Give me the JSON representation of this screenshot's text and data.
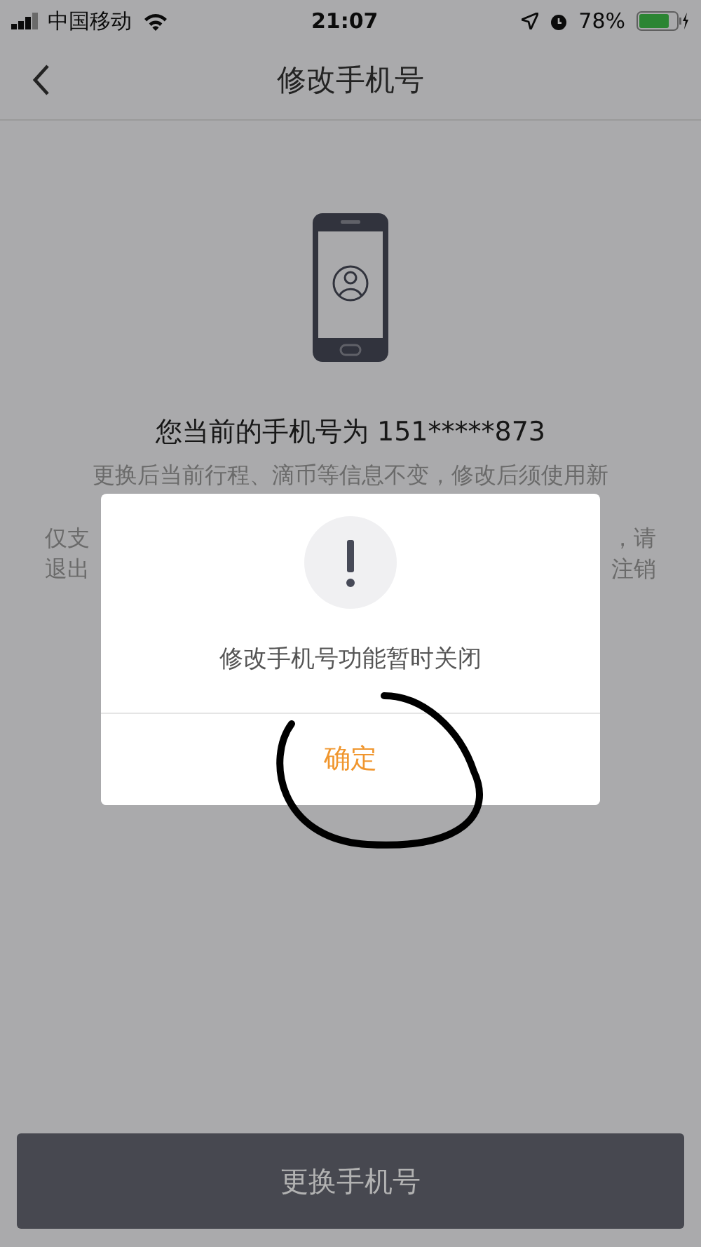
{
  "status_bar": {
    "carrier": "中国移动",
    "time": "21:07",
    "battery": "78%"
  },
  "nav_bar": {
    "title": "修改手机号"
  },
  "current_number": "您当前的手机号为 151*****873",
  "notice_line": "更换后当前行程、滴币等信息不变，修改后须使用新",
  "notice_fragments": [
    {
      "left": "仅支",
      "right": "，请"
    },
    {
      "left": "退出",
      "right": "注销"
    }
  ],
  "primary_button": "更换手机号",
  "dialog": {
    "message": "修改手机号功能暂时关闭",
    "confirm": "确定"
  }
}
